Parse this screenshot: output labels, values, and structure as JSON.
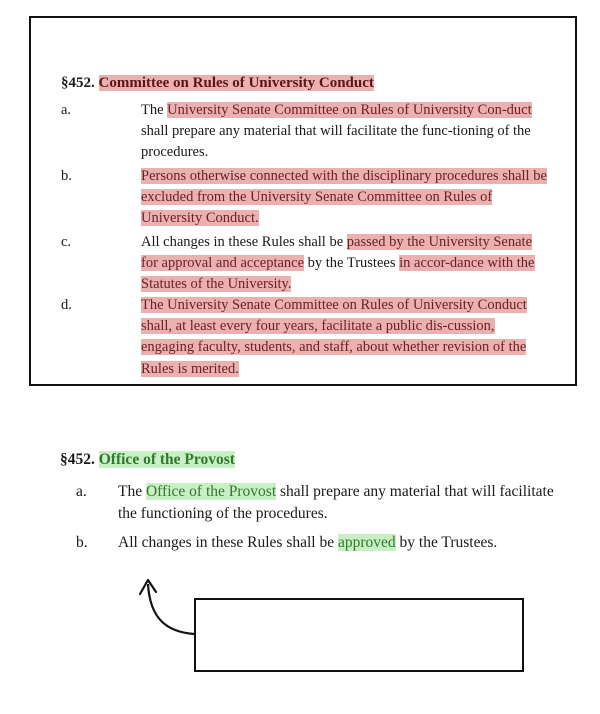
{
  "old_section": {
    "number": "§452.",
    "title": "Committee on Rules of University Conduct",
    "items": [
      {
        "letter": "a.",
        "parts": [
          {
            "text": "The ",
            "hl": ""
          },
          {
            "text": "University Senate Committee on Rules of University Con-duct",
            "hl": "red"
          },
          {
            "text": " shall prepare any material that will facilitate the func-tioning of the procedures.",
            "hl": ""
          }
        ]
      },
      {
        "letter": "b.",
        "parts": [
          {
            "text": "Persons otherwise connected with the disciplinary procedures shall be excluded from the University Senate Committee on Rules of University Conduct.",
            "hl": "red"
          }
        ]
      },
      {
        "letter": "c.",
        "parts": [
          {
            "text": "All changes in these Rules shall be ",
            "hl": ""
          },
          {
            "text": "passed by the University Senate for approval and acceptance",
            "hl": "red"
          },
          {
            "text": " by the Trustees ",
            "hl": ""
          },
          {
            "text": "in accor-dance with the Statutes of the University.",
            "hl": "red"
          }
        ]
      },
      {
        "letter": "d.",
        "parts": [
          {
            "text": "The University Senate Committee on Rules of University Conduct shall, at least every four years, facilitate a public dis-cussion, engaging faculty, students, and staff, about whether revision of the Rules is merited.",
            "hl": "red"
          }
        ]
      }
    ]
  },
  "new_section": {
    "number": "§452.",
    "title": "Office of the Provost",
    "items": [
      {
        "letter": "a.",
        "parts": [
          {
            "text": "The ",
            "hl": ""
          },
          {
            "text": "Office of the Provost",
            "hl": "green"
          },
          {
            "text": " shall prepare any material that will facilitate the functioning of the procedures.",
            "hl": ""
          }
        ]
      },
      {
        "letter": "b.",
        "parts": [
          {
            "text": "All changes in these Rules shall be ",
            "hl": ""
          },
          {
            "text": "approved",
            "hl": "green"
          },
          {
            "text": " by the Trustees.",
            "hl": ""
          }
        ]
      }
    ]
  },
  "colors": {
    "removed_highlight": "#ebb1b1",
    "added_highlight": "#c9f0c4"
  }
}
